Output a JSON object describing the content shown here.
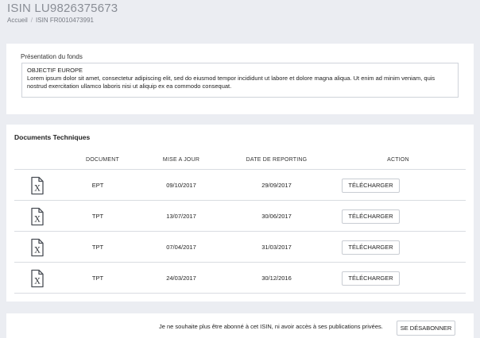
{
  "header": {
    "title": "ISIN LU9826375673",
    "breadcrumb": [
      "Accueil",
      "ISIN FR0010473991"
    ]
  },
  "presentation": {
    "label": "Présentation du fonds",
    "heading": "OBJECTIF EUROPE",
    "body": "Lorem ipsum dolor sit amet, consectetur adipiscing elit, sed do eiusmod tempor incididunt ut labore et dolore magna aliqua. Ut enim ad minim veniam, quis nostrud exercitation ullamco laboris nisi ut aliquip ex ea commodo consequat."
  },
  "documents": {
    "title": "Documents Techniques",
    "columns": [
      "DOCUMENT",
      "MISE A JOUR",
      "DATE DE REPORTING",
      "ACTION"
    ],
    "file_icon": "excel-file-icon",
    "rows": [
      {
        "document": "EPT",
        "mise_a_jour": "09/10/2017",
        "date_reporting": "29/09/2017",
        "action": "TÉLÉCHARGER"
      },
      {
        "document": "TPT",
        "mise_a_jour": "13/07/2017",
        "date_reporting": "30/06/2017",
        "action": "TÉLÉCHARGER"
      },
      {
        "document": "TPT",
        "mise_a_jour": "07/04/2017",
        "date_reporting": "31/03/2017",
        "action": "TÉLÉCHARGER"
      },
      {
        "document": "TPT",
        "mise_a_jour": "24/03/2017",
        "date_reporting": "30/12/2016",
        "action": "TÉLÉCHARGER"
      }
    ]
  },
  "unsubscribe": {
    "text": "Je ne souhaite plus être abonné à cet ISIN, ni avoir accès à ses publications privées.",
    "button": "SE DÉSABONNER"
  },
  "colors": {
    "background": "#ebedf2",
    "card": "#ffffff",
    "border": "#cfd3da",
    "title": "#8a8e96"
  }
}
